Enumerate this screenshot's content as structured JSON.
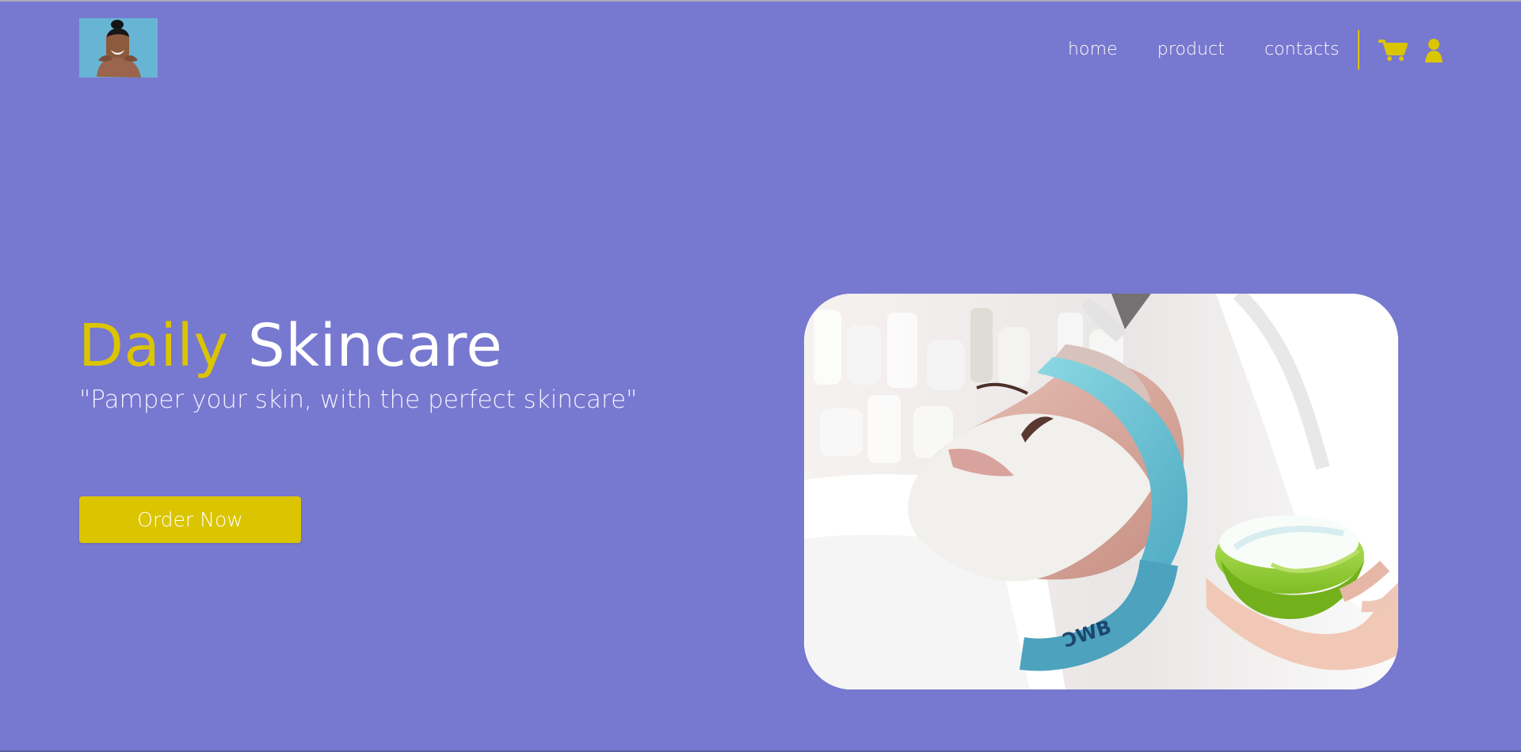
{
  "nav": {
    "items": [
      {
        "label": "home"
      },
      {
        "label": "product"
      },
      {
        "label": "contacts"
      }
    ],
    "icons": [
      "cart-icon",
      "user-icon"
    ]
  },
  "hero": {
    "title_accent": "Daily",
    "title_main": "Skincare",
    "subtitle": "\"Pamper your skin, with the perfect skincare\"",
    "button_label": "Order Now"
  },
  "theme": {
    "background": "#7778cf",
    "accent": "#dbc400",
    "text": "#ffffff"
  }
}
